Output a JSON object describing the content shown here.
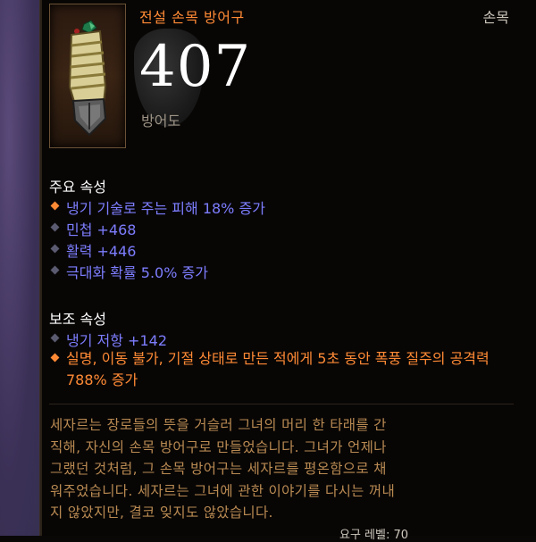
{
  "item": {
    "name": "전설 손목 방어구",
    "slot": "손목",
    "armor_value": "407",
    "armor_label": "방어도",
    "icon": "bracer-icon"
  },
  "primary": {
    "title": "주요 속성",
    "stats": [
      {
        "text": "냉기 기술로 주는 피해 18% 증가",
        "color": "blue"
      },
      {
        "text": "민첩 +468",
        "color": "blue"
      },
      {
        "text": "활력 +446",
        "color": "blue"
      },
      {
        "text": "극대화 확률 5.0% 증가",
        "color": "blue"
      }
    ]
  },
  "secondary": {
    "title": "보조 속성",
    "stats": [
      {
        "text": "냉기 저항 +142",
        "color": "blue"
      },
      {
        "text": "실명, 이동 불가, 기절 상태로 만든 적에게 5초 동안 폭풍 질주의 공격력 788% 증가",
        "color": "orange"
      }
    ]
  },
  "flavor_text": "세자르는 장로들의 뜻을 거슬러 그녀의 머리 한 타래를 간\n직해, 자신의 손목 방어구로 만들었습니다. 그녀가 언제나\n그랬던 것처럼, 그 손목 방어구는 세자르를 평온함으로 채\n워주었습니다. 세자르는 그녀에 관한 이야기를 다시는 꺼내\n지 않았지만, 결코 잊지도 않았습니다.",
  "footer_partial": "요구 레벨: 70",
  "colors": {
    "legendary": "#ff8a35",
    "magic": "#7d7dff",
    "flavor": "#b98a52",
    "label": "#9c9386"
  }
}
